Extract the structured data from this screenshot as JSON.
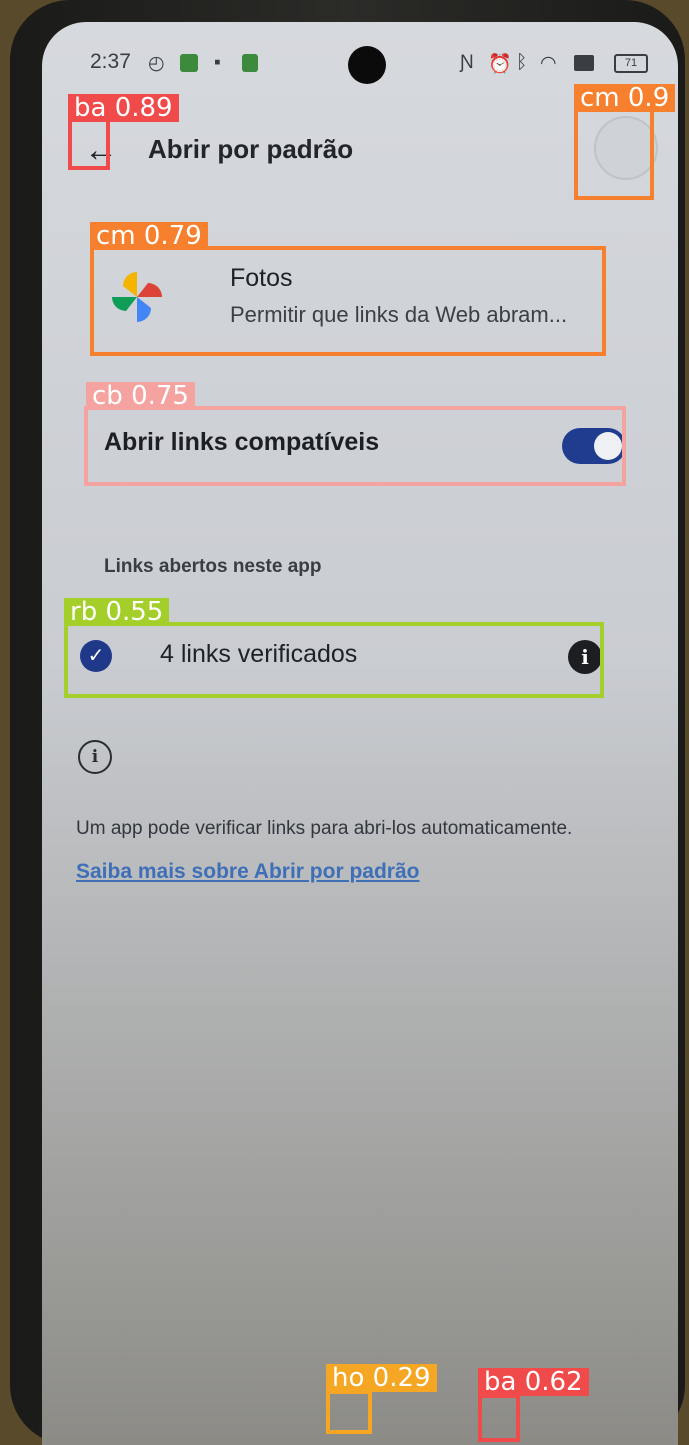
{
  "status_bar": {
    "time": "2:37",
    "battery": "71"
  },
  "header": {
    "title": "Abrir por padrão"
  },
  "app": {
    "name": "Fotos",
    "description": "Permitir que links da Web abram..."
  },
  "toggle": {
    "label": "Abrir links compatíveis",
    "on": true
  },
  "links_section": {
    "heading": "Links abertos neste app",
    "verified_label": "4 links verificados"
  },
  "footer": {
    "text": "Um app pode verificar links para abri-los automaticamente.",
    "link": "Saiba mais sobre Abrir por padrão"
  },
  "detections": [
    {
      "label": "ba 0.89",
      "color": "#f04a4a"
    },
    {
      "label": "cm 0.9",
      "color": "#f7802e"
    },
    {
      "label": "cm 0.79",
      "color": "#f7802e"
    },
    {
      "label": "cb 0.75",
      "color": "#f4a3a0"
    },
    {
      "label": "rb 0.55",
      "color": "#a4cf2a"
    },
    {
      "label": "ho 0.29",
      "color": "#f5a623"
    },
    {
      "label": "ba 0.62",
      "color": "#f04a4a"
    }
  ],
  "colors": {
    "accent": "#1f3c8f",
    "link": "#3e6fb7"
  }
}
